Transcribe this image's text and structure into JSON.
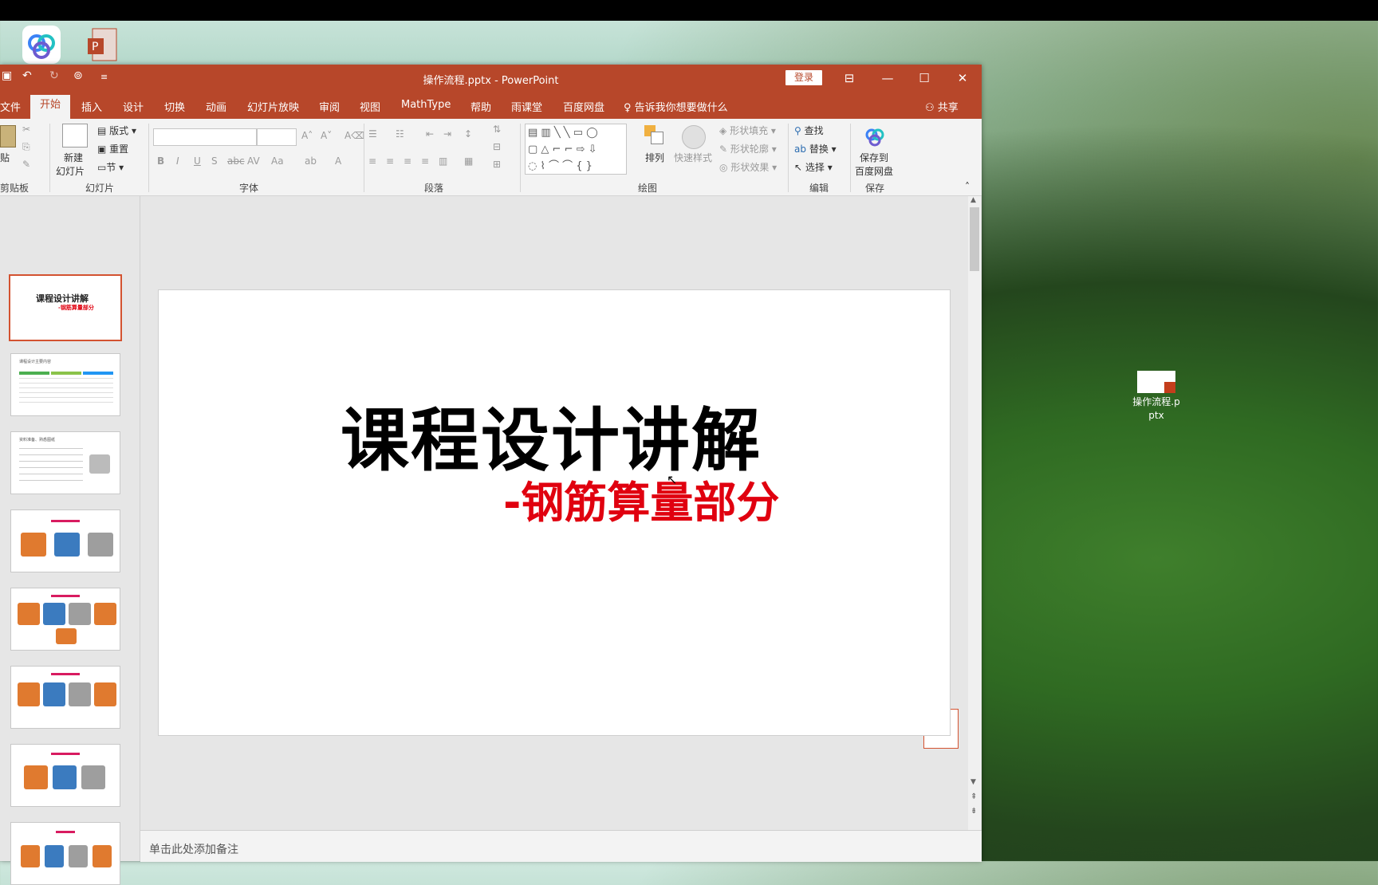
{
  "desktop": {
    "file_icon_label": "操作流程.pptx"
  },
  "window": {
    "title": "操作流程.pptx  -  PowerPoint",
    "login_label": "登录"
  },
  "tabs": [
    {
      "label": "文件"
    },
    {
      "label": "开始"
    },
    {
      "label": "插入"
    },
    {
      "label": "设计"
    },
    {
      "label": "切换"
    },
    {
      "label": "动画"
    },
    {
      "label": "幻灯片放映"
    },
    {
      "label": "审阅"
    },
    {
      "label": "视图"
    },
    {
      "label": "MathType"
    },
    {
      "label": "帮助"
    },
    {
      "label": "雨课堂"
    },
    {
      "label": "百度网盘"
    }
  ],
  "tell_me": "告诉我你想要做什么",
  "share": "共享",
  "ribbon": {
    "clipboard": {
      "paste": "贴",
      "label": "剪贴板"
    },
    "slides": {
      "new_slide_1": "新建",
      "new_slide_2": "幻灯片",
      "layout": "版式",
      "reset": "重置",
      "section": "节",
      "label": "幻灯片"
    },
    "font": {
      "label": "字体"
    },
    "paragraph": {
      "label": "段落"
    },
    "drawing": {
      "arrange": "排列",
      "quick_styles": "快速样式",
      "shape_fill": "形状填充",
      "shape_outline": "形状轮廓",
      "shape_effects": "形状效果",
      "label": "绘图"
    },
    "editing": {
      "find": "查找",
      "replace": "替换",
      "select": "选择",
      "label": "编辑"
    },
    "save": {
      "save_to_1": "保存到",
      "save_to_2": "百度网盘",
      "label": "保存"
    }
  },
  "thumbnails": {
    "slide1_title": "课程设计讲解",
    "slide1_sub": "-钢筋算量部分",
    "slide2_title": "课程设计主要内容",
    "slide3_title": "资料准备、熟悉图纸"
  },
  "slide": {
    "title": "课程设计讲解",
    "subtitle": "-钢筋算量部分"
  },
  "notes_placeholder": "单击此处添加备注",
  "colors": {
    "accent": "#b7472a",
    "subtitle": "#e0000f"
  }
}
